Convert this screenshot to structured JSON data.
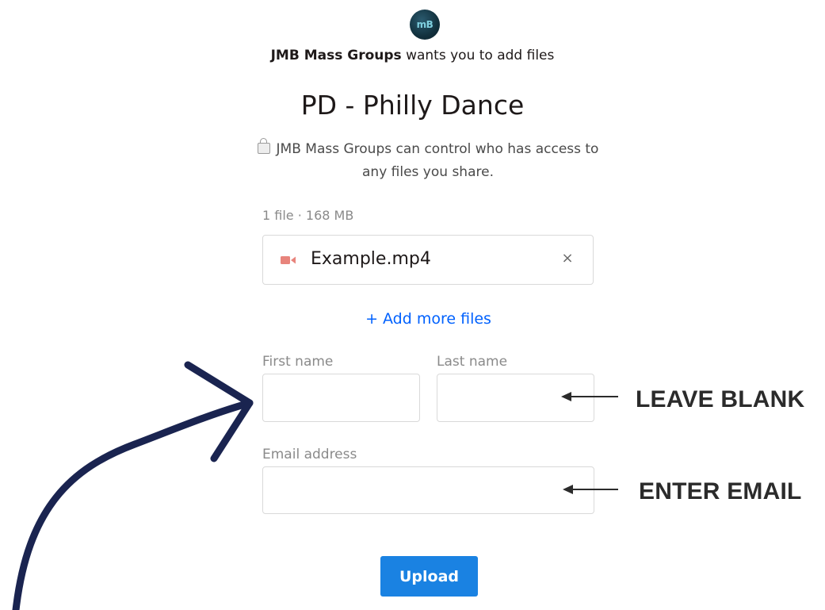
{
  "header": {
    "avatar_text": "mB",
    "requester_name": "JMB Mass Groups",
    "requester_suffix": " wants you to add files",
    "request_title": "PD - Philly Dance",
    "privacy_note": "JMB Mass Groups can control who has access to any files you share."
  },
  "files": {
    "summary": "1 file · 168 MB",
    "items": [
      {
        "name": "Example.mp4",
        "remove_label": "×",
        "icon": "video-icon"
      }
    ],
    "add_more_label": "+ Add more files"
  },
  "form": {
    "first_name_label": "First name",
    "first_name_value": "",
    "last_name_label": "Last name",
    "last_name_value": "",
    "email_label": "Email address",
    "email_value": "",
    "upload_label": "Upload"
  },
  "annotations": {
    "leave_blank": "LEAVE BLANK",
    "enter_email": "ENTER EMAIL"
  },
  "colors": {
    "accent": "#1a82e2",
    "link": "#0061fe",
    "video_icon": "#e8847c",
    "annotation_arrow": "#1a2450"
  }
}
